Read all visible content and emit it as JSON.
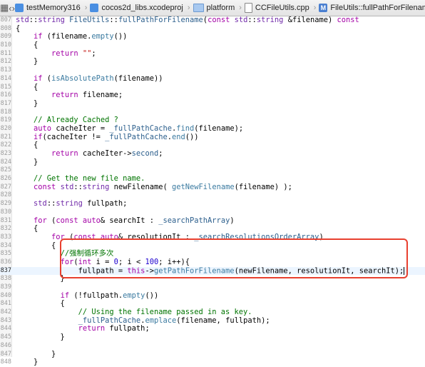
{
  "toolbar": {
    "crumbs": [
      "testMemory316",
      "cocos2d_libs.xcodeproj",
      "platform",
      "CCFileUtils.cpp",
      "FileUtils::fullPathForFilename(const std::string &filename)"
    ]
  },
  "colors": {
    "keyword": "#a300a6",
    "type": "#6f28a8",
    "function": "#2b5e8c",
    "string": "#c41a16",
    "number": "#1c00cf",
    "comment": "#007400",
    "highlight_box": "#e8402f",
    "current_line": "#ecf5ff"
  },
  "current_line": "837",
  "lines": [
    {
      "n": "807",
      "segs": [
        {
          "t": "std",
          "c": "t"
        },
        {
          "t": "::",
          "c": ""
        },
        {
          "t": "string",
          "c": "t"
        },
        {
          "t": " ",
          "c": ""
        },
        {
          "t": "FileUtils",
          "c": "f"
        },
        {
          "t": "::",
          "c": ""
        },
        {
          "t": "fullPathForFilename",
          "c": "f"
        },
        {
          "t": "(",
          "c": ""
        },
        {
          "t": "const",
          "c": "k"
        },
        {
          "t": " ",
          "c": ""
        },
        {
          "t": "std",
          "c": "t"
        },
        {
          "t": "::",
          "c": ""
        },
        {
          "t": "string",
          "c": "t"
        },
        {
          "t": " &filename) ",
          "c": ""
        },
        {
          "t": "const",
          "c": "k"
        }
      ]
    },
    {
      "n": "808",
      "segs": [
        {
          "t": "{",
          "c": ""
        }
      ]
    },
    {
      "n": "809",
      "segs": [
        {
          "t": "    ",
          "c": ""
        },
        {
          "t": "if",
          "c": "k"
        },
        {
          "t": " (filename.",
          "c": ""
        },
        {
          "t": "empty",
          "c": "f2"
        },
        {
          "t": "())",
          "c": ""
        }
      ]
    },
    {
      "n": "810",
      "segs": [
        {
          "t": "    {",
          "c": ""
        }
      ]
    },
    {
      "n": "811",
      "segs": [
        {
          "t": "        ",
          "c": ""
        },
        {
          "t": "return",
          "c": "k"
        },
        {
          "t": " ",
          "c": ""
        },
        {
          "t": "\"\"",
          "c": "s"
        },
        {
          "t": ";",
          "c": ""
        }
      ]
    },
    {
      "n": "812",
      "segs": [
        {
          "t": "    }",
          "c": ""
        }
      ]
    },
    {
      "n": "813",
      "segs": []
    },
    {
      "n": "814",
      "segs": [
        {
          "t": "    ",
          "c": ""
        },
        {
          "t": "if",
          "c": "k"
        },
        {
          "t": " (",
          "c": ""
        },
        {
          "t": "isAbsolutePath",
          "c": "f2"
        },
        {
          "t": "(filename))",
          "c": ""
        }
      ]
    },
    {
      "n": "815",
      "segs": [
        {
          "t": "    {",
          "c": ""
        }
      ]
    },
    {
      "n": "816",
      "segs": [
        {
          "t": "        ",
          "c": ""
        },
        {
          "t": "return",
          "c": "k"
        },
        {
          "t": " filename;",
          "c": ""
        }
      ]
    },
    {
      "n": "817",
      "segs": [
        {
          "t": "    }",
          "c": ""
        }
      ]
    },
    {
      "n": "818",
      "segs": []
    },
    {
      "n": "819",
      "segs": [
        {
          "t": "    ",
          "c": ""
        },
        {
          "t": "// Already Cached ?",
          "c": "c"
        }
      ]
    },
    {
      "n": "820",
      "segs": [
        {
          "t": "    ",
          "c": ""
        },
        {
          "t": "auto",
          "c": "k"
        },
        {
          "t": " cacheIter = ",
          "c": ""
        },
        {
          "t": "_fullPathCache",
          "c": "f"
        },
        {
          "t": ".",
          "c": ""
        },
        {
          "t": "find",
          "c": "f2"
        },
        {
          "t": "(filename);",
          "c": ""
        }
      ]
    },
    {
      "n": "821",
      "segs": [
        {
          "t": "    ",
          "c": ""
        },
        {
          "t": "if",
          "c": "k"
        },
        {
          "t": "(cacheIter != ",
          "c": ""
        },
        {
          "t": "_fullPathCache",
          "c": "f"
        },
        {
          "t": ".",
          "c": ""
        },
        {
          "t": "end",
          "c": "f2"
        },
        {
          "t": "())",
          "c": ""
        }
      ]
    },
    {
      "n": "822",
      "segs": [
        {
          "t": "    {",
          "c": ""
        }
      ]
    },
    {
      "n": "823",
      "segs": [
        {
          "t": "        ",
          "c": ""
        },
        {
          "t": "return",
          "c": "k"
        },
        {
          "t": " cacheIter->",
          "c": ""
        },
        {
          "t": "second",
          "c": "f"
        },
        {
          "t": ";",
          "c": ""
        }
      ]
    },
    {
      "n": "824",
      "segs": [
        {
          "t": "    }",
          "c": ""
        }
      ]
    },
    {
      "n": "825",
      "segs": []
    },
    {
      "n": "826",
      "segs": [
        {
          "t": "    ",
          "c": ""
        },
        {
          "t": "// Get the new file name.",
          "c": "c"
        }
      ]
    },
    {
      "n": "827",
      "segs": [
        {
          "t": "    ",
          "c": ""
        },
        {
          "t": "const",
          "c": "k"
        },
        {
          "t": " ",
          "c": ""
        },
        {
          "t": "std",
          "c": "t"
        },
        {
          "t": "::",
          "c": ""
        },
        {
          "t": "string",
          "c": "t"
        },
        {
          "t": " newFilename( ",
          "c": ""
        },
        {
          "t": "getNewFilename",
          "c": "f2"
        },
        {
          "t": "(filename) );",
          "c": ""
        }
      ]
    },
    {
      "n": "828",
      "segs": []
    },
    {
      "n": "829",
      "segs": [
        {
          "t": "    ",
          "c": ""
        },
        {
          "t": "std",
          "c": "t"
        },
        {
          "t": "::",
          "c": ""
        },
        {
          "t": "string",
          "c": "t"
        },
        {
          "t": " fullpath;",
          "c": ""
        }
      ]
    },
    {
      "n": "830",
      "segs": []
    },
    {
      "n": "831",
      "segs": [
        {
          "t": "    ",
          "c": ""
        },
        {
          "t": "for",
          "c": "k"
        },
        {
          "t": " (",
          "c": ""
        },
        {
          "t": "const",
          "c": "k"
        },
        {
          "t": " ",
          "c": ""
        },
        {
          "t": "auto",
          "c": "k"
        },
        {
          "t": "& searchIt : ",
          "c": ""
        },
        {
          "t": "_searchPathArray",
          "c": "f"
        },
        {
          "t": ")",
          "c": ""
        }
      ]
    },
    {
      "n": "832",
      "segs": [
        {
          "t": "    {",
          "c": ""
        }
      ]
    },
    {
      "n": "833",
      "segs": [
        {
          "t": "        ",
          "c": ""
        },
        {
          "t": "for",
          "c": "k"
        },
        {
          "t": " (",
          "c": ""
        },
        {
          "t": "const",
          "c": "k"
        },
        {
          "t": " ",
          "c": ""
        },
        {
          "t": "auto",
          "c": "k"
        },
        {
          "t": "& resolutionIt : ",
          "c": ""
        },
        {
          "t": "_searchResolutionsOrderArray",
          "c": "f"
        },
        {
          "t": ")",
          "c": ""
        }
      ]
    },
    {
      "n": "834",
      "segs": [
        {
          "t": "        {",
          "c": ""
        }
      ]
    },
    {
      "n": "835",
      "segs": [
        {
          "t": "          ",
          "c": ""
        },
        {
          "t": "//强制循环多次",
          "c": "c"
        }
      ]
    },
    {
      "n": "836",
      "segs": [
        {
          "t": "          ",
          "c": ""
        },
        {
          "t": "for",
          "c": "k"
        },
        {
          "t": "(",
          "c": ""
        },
        {
          "t": "int",
          "c": "k"
        },
        {
          "t": " i = ",
          "c": ""
        },
        {
          "t": "0",
          "c": "n"
        },
        {
          "t": "; i < ",
          "c": ""
        },
        {
          "t": "100",
          "c": "n"
        },
        {
          "t": "; i++){",
          "c": ""
        }
      ]
    },
    {
      "n": "837",
      "segs": [
        {
          "t": "              fullpath = ",
          "c": ""
        },
        {
          "t": "this",
          "c": "k"
        },
        {
          "t": "->",
          "c": ""
        },
        {
          "t": "getPathForFilename",
          "c": "f2"
        },
        {
          "t": "(newFilename, resolutionIt, searchIt);",
          "c": ""
        }
      ]
    },
    {
      "n": "838",
      "segs": [
        {
          "t": "          }",
          "c": ""
        }
      ]
    },
    {
      "n": "839",
      "segs": []
    },
    {
      "n": "840",
      "segs": [
        {
          "t": "          ",
          "c": ""
        },
        {
          "t": "if",
          "c": "k"
        },
        {
          "t": " (!fullpath.",
          "c": ""
        },
        {
          "t": "empty",
          "c": "f2"
        },
        {
          "t": "())",
          "c": ""
        }
      ]
    },
    {
      "n": "841",
      "segs": [
        {
          "t": "          {",
          "c": ""
        }
      ]
    },
    {
      "n": "842",
      "segs": [
        {
          "t": "              ",
          "c": ""
        },
        {
          "t": "// Using the filename passed in as key.",
          "c": "c"
        }
      ]
    },
    {
      "n": "843",
      "segs": [
        {
          "t": "              ",
          "c": ""
        },
        {
          "t": "_fullPathCache",
          "c": "f"
        },
        {
          "t": ".",
          "c": ""
        },
        {
          "t": "emplace",
          "c": "f2"
        },
        {
          "t": "(filename, fullpath);",
          "c": ""
        }
      ]
    },
    {
      "n": "844",
      "segs": [
        {
          "t": "              ",
          "c": ""
        },
        {
          "t": "return",
          "c": "k"
        },
        {
          "t": " fullpath;",
          "c": ""
        }
      ]
    },
    {
      "n": "845",
      "segs": [
        {
          "t": "          }",
          "c": ""
        }
      ]
    },
    {
      "n": "846",
      "segs": []
    },
    {
      "n": "847",
      "segs": [
        {
          "t": "        }",
          "c": ""
        }
      ]
    },
    {
      "n": "848",
      "segs": [
        {
          "t": "    }",
          "c": ""
        }
      ]
    }
  ]
}
